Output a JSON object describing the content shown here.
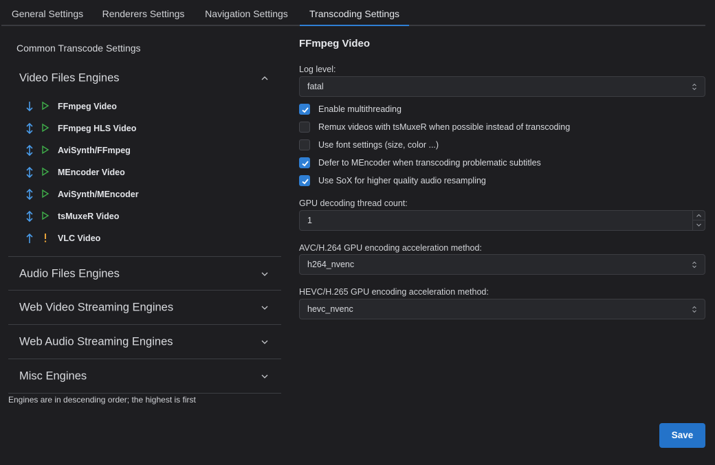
{
  "tabs": [
    {
      "label": "General Settings"
    },
    {
      "label": "Renderers Settings"
    },
    {
      "label": "Navigation Settings"
    },
    {
      "label": "Transcoding Settings",
      "active": true
    }
  ],
  "left": {
    "common_label": "Common Transcode Settings",
    "sections": [
      {
        "label": "Video Files Engines",
        "expanded": true
      },
      {
        "label": "Audio Files Engines",
        "expanded": false
      },
      {
        "label": "Web Video Streaming Engines",
        "expanded": false
      },
      {
        "label": "Web Audio Streaming Engines",
        "expanded": false
      },
      {
        "label": "Misc Engines",
        "expanded": false
      }
    ],
    "engines": [
      {
        "name": "FFmpeg Video",
        "move": "down",
        "status": "play"
      },
      {
        "name": "FFmpeg HLS Video",
        "move": "updown",
        "status": "play"
      },
      {
        "name": "AviSynth/FFmpeg",
        "move": "updown",
        "status": "play"
      },
      {
        "name": "MEncoder Video",
        "move": "updown",
        "status": "play"
      },
      {
        "name": "AviSynth/MEncoder",
        "move": "updown",
        "status": "play"
      },
      {
        "name": "tsMuxeR Video",
        "move": "updown",
        "status": "play"
      },
      {
        "name": "VLC Video",
        "move": "up",
        "status": "warning"
      }
    ],
    "footnote": "Engines are in descending order; the highest is first"
  },
  "right": {
    "title": "FFmpeg Video",
    "log_level": {
      "label": "Log level:",
      "value": "fatal"
    },
    "checkboxes": [
      {
        "label": "Enable multithreading",
        "checked": true
      },
      {
        "label": "Remux videos with tsMuxeR when possible instead of transcoding",
        "checked": false
      },
      {
        "label": "Use font settings (size, color ...)",
        "checked": false
      },
      {
        "label": "Defer to MEncoder when transcoding problematic subtitles",
        "checked": true
      },
      {
        "label": "Use SoX for higher quality audio resampling",
        "checked": true
      }
    ],
    "gpu_threads": {
      "label": "GPU decoding thread count:",
      "value": "1"
    },
    "avc_method": {
      "label": "AVC/H.264 GPU encoding acceleration method:",
      "value": "h264_nvenc"
    },
    "hevc_method": {
      "label": "HEVC/H.265 GPU encoding acceleration method:",
      "value": "hevc_nvenc"
    }
  },
  "save_label": "Save",
  "colors": {
    "accent": "#2f7fd4",
    "play_icon": "#3fae4a",
    "warning_icon": "#e8a33a",
    "move_icon": "#4a9be8"
  }
}
